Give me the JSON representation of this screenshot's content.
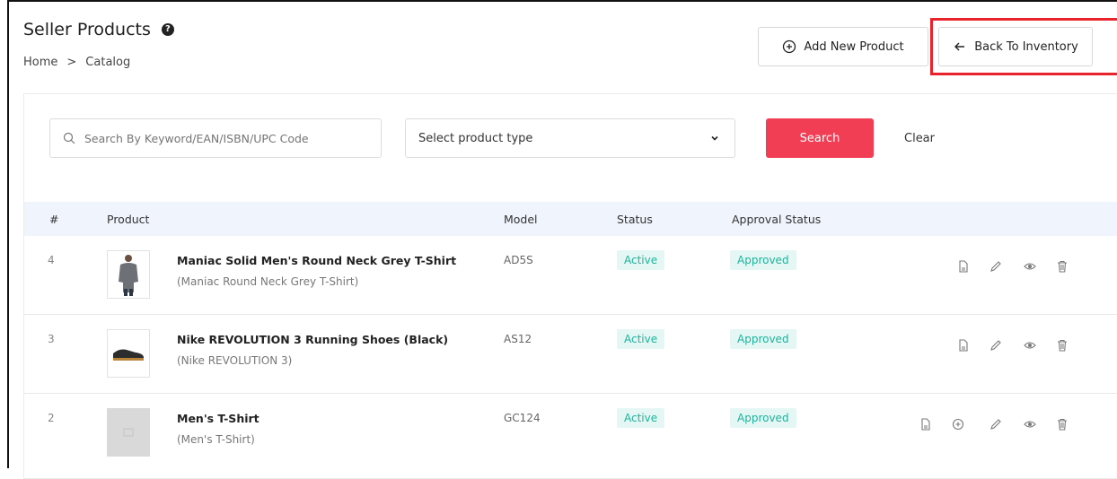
{
  "header": {
    "title": "Seller Products",
    "help_icon": "?",
    "breadcrumb": [
      "Home",
      ">",
      "Catalog"
    ]
  },
  "actions": {
    "add_label": "Add New Product",
    "back_label": "Back To Inventory"
  },
  "filters": {
    "search_placeholder": "Search By Keyword/EAN/ISBN/UPC Code",
    "select_label": "Select product type",
    "search_button": "Search",
    "clear_button": "Clear"
  },
  "table": {
    "columns": {
      "num": "#",
      "product": "Product",
      "model": "Model",
      "status": "Status",
      "approval": "Approval Status"
    },
    "rows": [
      {
        "num": "4",
        "name": "Maniac Solid Men's Round Neck Grey T-Shirt",
        "sub": "(Maniac Round Neck Grey T-Shirt)",
        "model": "AD5S",
        "status": "Active",
        "approval": "Approved",
        "thumb": "grey-tshirt-person"
      },
      {
        "num": "3",
        "name": "Nike REVOLUTION 3 Running Shoes (Black)",
        "sub": "(Nike REVOLUTION 3)",
        "model": "AS12",
        "status": "Active",
        "approval": "Approved",
        "thumb": "black-shoe"
      },
      {
        "num": "2",
        "name": "Men's T-Shirt",
        "sub": "(Men's T-Shirt)",
        "model": "GC124",
        "status": "Active",
        "approval": "Approved",
        "thumb": "placeholder"
      }
    ]
  },
  "colors": {
    "accent": "#f13e54",
    "highlight": "#e8232c",
    "badge_bg": "#e4f7f4",
    "badge_text": "#20b29b",
    "header_bg": "#f0f5fd"
  }
}
